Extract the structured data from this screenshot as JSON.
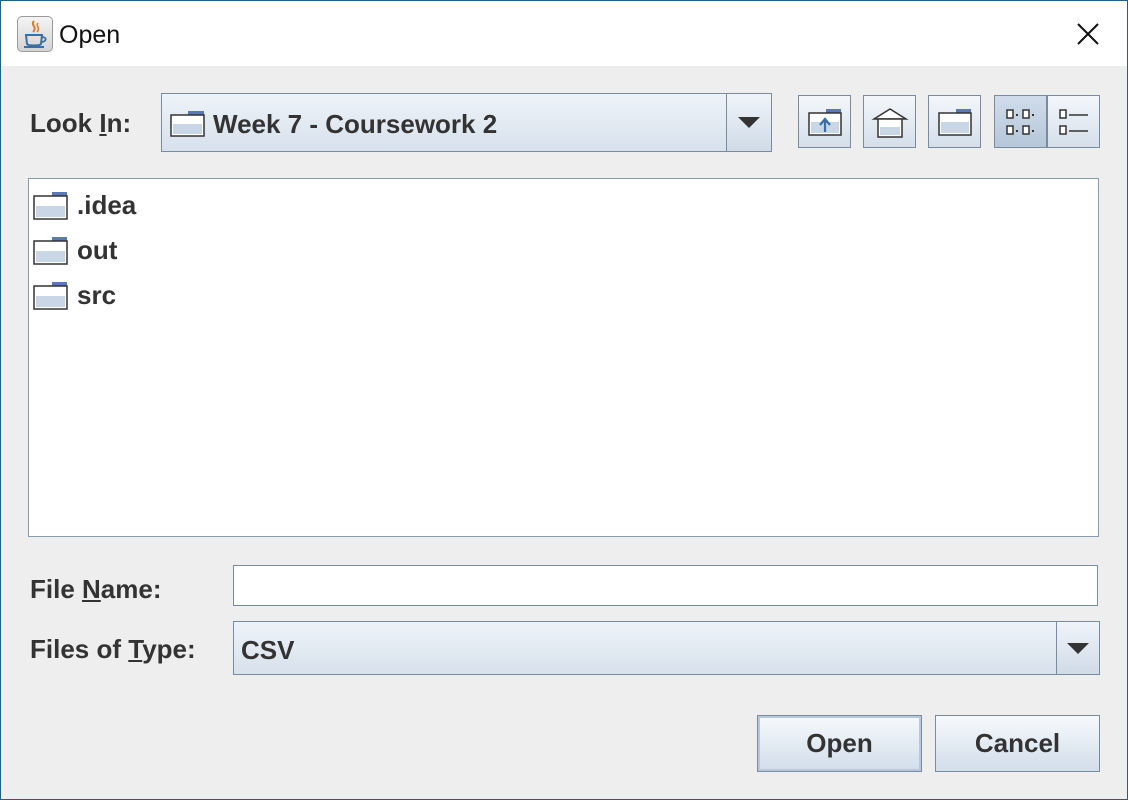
{
  "window": {
    "title": "Open",
    "app_icon": "java-icon",
    "close_icon": "close-icon"
  },
  "look_in": {
    "label_pre": "Look ",
    "label_mnemonic": "I",
    "label_post": "n:",
    "selected": "Week 7 - Coursework 2",
    "icon": "folder-icon"
  },
  "toolbar": {
    "buttons": [
      {
        "name": "up-one-level",
        "icon": "folder-up-icon"
      },
      {
        "name": "home",
        "icon": "home-icon"
      },
      {
        "name": "create-new-folder",
        "icon": "new-folder-icon"
      },
      {
        "name": "list-view",
        "icon": "list-view-icon",
        "selected": true
      },
      {
        "name": "details-view",
        "icon": "details-view-icon",
        "selected": false
      }
    ]
  },
  "file_list": {
    "items": [
      {
        "name": ".idea",
        "icon": "folder-icon"
      },
      {
        "name": "out",
        "icon": "folder-icon"
      },
      {
        "name": "src",
        "icon": "folder-icon"
      }
    ]
  },
  "file_name": {
    "label_pre": "File ",
    "label_mnemonic": "N",
    "label_post": "ame:",
    "value": ""
  },
  "file_type": {
    "label_pre": "Files of ",
    "label_mnemonic": "T",
    "label_post": "ype:",
    "selected": "CSV"
  },
  "buttons": {
    "open": "Open",
    "cancel": "Cancel"
  },
  "colors": {
    "background": "#eeeeee",
    "window_border": "#1f5f8a",
    "control_border": "#7a8ba0",
    "folder_tab": "#5b79b8"
  }
}
